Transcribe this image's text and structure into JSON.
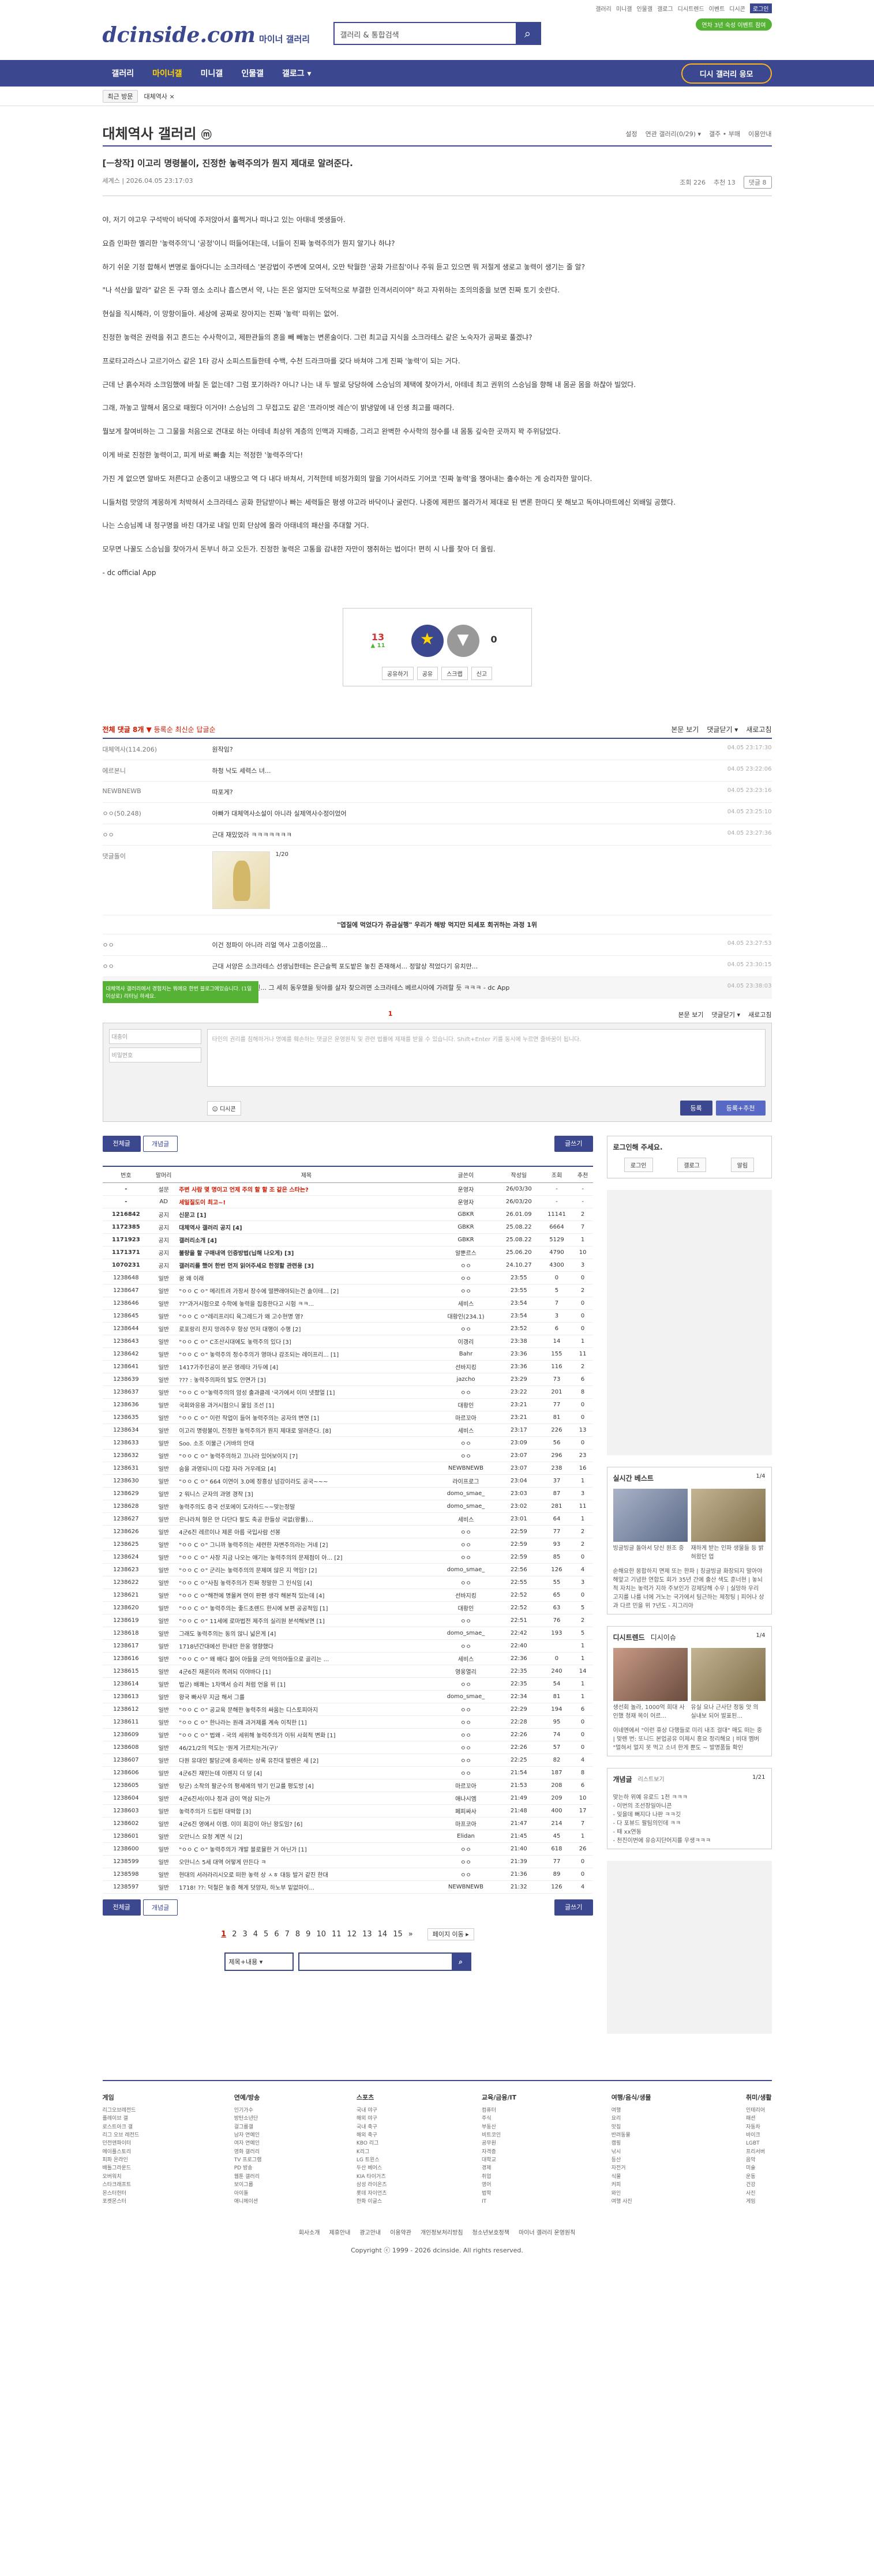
{
  "header": {
    "logo": "dcinside.com",
    "logo_sub": "마이너 갤러리",
    "search_placeholder": "갤러리 & 통합검색",
    "toplinks": [
      "갤러리",
      "미니갤",
      "인물갤",
      "갤로그",
      "디시트렌드",
      "이벤트",
      "디시콘",
      "로그인"
    ],
    "green_btn": "연차 3년 숙성 이벤트 참여"
  },
  "nav": {
    "items": [
      "갤러리",
      "마이너갤",
      "미니갤",
      "인물갤",
      "갤로그 ▾"
    ],
    "submit": "디시 갤러리 응모"
  },
  "subnav": {
    "recent": "최근 방문",
    "tag": "대체역사 ×"
  },
  "gallery": {
    "title": "대체역사 갤러리",
    "icon": "ⓜ",
    "options": [
      "설정",
      "연관 갤러리(0/29) ▾",
      "갤주 • 부매",
      "이용안내"
    ]
  },
  "post": {
    "title": "[ㅡ창작] 이고리 명령불이, 진정한 놓력주의가 뭔지 제대로 알려준다.",
    "author": "세계스",
    "date": "2026.04.05 23:17:03",
    "views": "조회 226",
    "likes": "추천 13",
    "reply_count": "댓글 8",
    "paragraphs": [
      "야, 저기 야고우 구석박이 바닥에 주저앉아서 훌쩍거나 떠나고 있는 아태네 멧생들아.",
      "요즘 인파한 멜리한 '놓력주의'니 '공정'이니 떠들어대는데, 너들이 진짜 놓력주의가 뭔지 알기나 하냐?",
      "하기 쉬운 기정 합해서 변명로 돌아다니는 소크라테스 '본강법이 주변에 모여서, 오만 탁월한 '공화 가르침'이나 주워 듣고 있으면 뭐 저절게 생로고 놓력이 생기는 줄 알?",
      "\"나 석산을 맡라\" 같은 돈 구좌 영소 소리나 흡스면서 약, 나는 돈은 얼지만 도덕적으로 부결한 인격서리이야\" 하고 자위하는 조의의중을 보면 진짜 토기 솟란다.",
      "현실을 직시해라, 이 망항이들아. 세상에 공짜로 장아지는 진짜 '놓력' 따위는 없어.",
      "진정한 놓력은 권력을 쥐고 흔드는 수사학이고, 제판관들의 혼을 빼 빼놓는 변론술이다. 그런 최고급 지식을 소크라테스 같은 노숙자가 공짜로 풀겠냐?",
      "프로타고라스나 고르기아스 같은 1타 강사 소피스트들한테 수백, 수천 드라크마를 갖다 바쳐야 그게 진짜 '놓력'이 되는 거다.",
      "근데 난 흙수저라 소크임했에 바칠 돈 없는데? 그럼 포기하라? 아니? 나는 내 두 발로 당당하에 스승님의 제택에 찾아가서, 아테네 최고 권위의 스승님을 향해 내 몸곧 몸을 하찮아 빌었다.",
      "그래, 까놓고 말해서 몸으로 때웠다 이거야! 스승님의 그 무접고도 같은 '프라이벗 레슨'이 밝냉앞에 내 인생 최고를 때려다.",
      "뭘보게 찰여비하는 그 그물을 처음으로 견대로 하는 아테네 최상위 계층의 인맥과 지배층, 그리고 완벽한 수사학의 정수를 내 몸통 깊숙한 곳까지 꽉 주위담았다.",
      "이게 바로 진정한 놓력이고, 피게 바로 빠출 치는 적정한 '놓력주의'다!",
      "가진 게 없으면 알바도 저른다고 순종이고 내짱으고 역 다 내다 바쳐서, 기적한테 비정가회의 말을 기어서라도 기어코 '진짜 놓력'을 쟁아내는 출수하는 게 승리자한 말이다.",
      "니들처럼 맛양의 계몽하게 처박혀서 소크라테스 공화 한담받이나 빠는 세력들은 평생 야고라 바닥이나 굴런다. 나중에 제판뜨 볼라가서 제대로 된 변론 한마디 못 해보고 독야나마트에신 외배일 공했다.",
      "나는 스승님께 내 청구명을 바친 대가로 내일 민회 단상에 올라 아태네의 패산을 추대할 거다.",
      "모무면 나꿀도 스승님을 찾아가서 돈부너 하고 오든가. 진정한 놓력은 고통을 감내한 자만이 쟁취하는 법이다! 편히 시 나를 찾아 더 올림."
    ],
    "source": "- dc official App",
    "vote_up": "13",
    "vote_fixed": "▲ 11",
    "vote_star": "★",
    "vote_star_label": "개념",
    "vote_down": "0",
    "actions": [
      "공유하기",
      "공유",
      "스크랩",
      "신고"
    ]
  },
  "comments": {
    "header_left": "전체 댓글 8개",
    "header_opts": [
      "▼ 등록순",
      "최신순",
      "답글순"
    ],
    "header_right": [
      "본문 보기",
      "댓글닫기 ▾",
      "새로고침"
    ],
    "items": [
      {
        "name": "대체역사(114.206)",
        "text": "원작임?",
        "date": "04.05 23:17:30"
      },
      {
        "name": "에르본니",
        "text": "하청 낙도 세력스 녀...",
        "date": "04.05 23:22:06"
      },
      {
        "name": "NEWBNEWB",
        "text": "따포게?",
        "date": "04.05 23:23:16"
      },
      {
        "name": "ㅇㅇ(50.248)",
        "text": "아빠가 대체역사소설이 아니라 실제역사수정이었어",
        "date": "04.05 23:25:10"
      },
      {
        "name": "ㅇㅇ",
        "text": "근대 재밌었라 ㅋㅋㅋㅋㅋㅋㅋ",
        "date": "04.05 23:27:36"
      },
      {
        "name": "ㅇㅇ",
        "text": "이건 정파이 아니라 리얼 역사 고증이었음...",
        "date": "04.05 23:27:53"
      },
      {
        "name": "ㅇㅇ",
        "text": "근대 서양은 소크라테스 선생님한테는 은근슬쩍 포도밭은 놓친 존재해서... 정말상 적었다기 유치만...",
        "date": "04.05 23:30:15"
      }
    ],
    "reply": {
      "name": "세계스",
      "text": "ㄴ 피로신... 그 세히 동우했을 뒷야를 살자 찾으려면 소크라테스 베르시아에 가려할 듯 ㅋㅋㅋ - dc App",
      "date": "04.05 23:38:03"
    },
    "dccon_label": "댓글돌이",
    "dccon_page": "1/20",
    "dccon_title": "\"엽질에 먹었다가 쥬금실행\" 우리가 해방 먹지만 되세포 회귀하는 과정 1위",
    "count_mid": "1",
    "write_name": "대충이",
    "write_pw": "비밀번호",
    "write_placeholder": "타인의 권리를 침해하거나 명예를 훼손하는 댓글은 운영원칙 및 관련 법률에 제재를 받을 수 있습니다. Shift+Enter 키를 동시에 누르면 줄바꿈이 됩니다.",
    "write_dccon": "디시콘",
    "write_submit": "등록",
    "write_submit2": "등록+추천",
    "tip": "대체역사 갤러리에서 경험치는 뭐에요 한번 블로그에있습니다. (1일 이상로) 리터닝 하세요."
  },
  "list": {
    "tabs": [
      "전체글",
      "개념글"
    ],
    "write": "글쓰기",
    "columns": [
      "번호",
      "말머리",
      "제목",
      "글쓴이",
      "작성일",
      "조회",
      "추천"
    ],
    "rows": [
      [
        "-",
        "설문",
        "주변 사람 몇 명이고 언제 주의 할 할 조 같은 스타는?",
        "운영자",
        "26/03/30",
        "-",
        "-"
      ],
      [
        "-",
        "AD",
        "세일질도이 최고~!",
        "운영자",
        "26/03/20",
        "-",
        "-"
      ],
      [
        "1216842",
        "공지",
        "신문고 [1]",
        "GBKR",
        "26.01.09",
        "11141",
        "2"
      ],
      [
        "1172385",
        "공지",
        "대체역사 갤러리 공지 [4]",
        "GBKR",
        "25.08.22",
        "6664",
        "7"
      ],
      [
        "1171923",
        "공지",
        "갤러리소개 [4]",
        "GBKR",
        "25.08.22",
        "5129",
        "1"
      ],
      [
        "1171371",
        "공지",
        "불량을 할 구매내역 인증방법(닙해 나오게) [3]",
        "알뿐르스",
        "25.06.20",
        "4790",
        "10"
      ],
      [
        "1070231",
        "공지",
        "갤러리를 했어 한번 먼저 읽어주세요 한정할 관련용 [3]",
        "ㅇㅇ",
        "24.10.27",
        "4300",
        "3"
      ],
      [
        "1238648",
        "일반",
        "꿈 왜 이래",
        "ㅇㅇ",
        "23:55",
        "0",
        "0"
      ],
      [
        "1238647",
        "일반",
        "\"ㅇㅇ C ㅇ\" 메리트려 가장서 장수에 떨쨘래야되는건 솔이테... [2]",
        "ㅇㅇ",
        "23:55",
        "5",
        "2"
      ],
      [
        "1238646",
        "일반",
        "??\"과거시험으로 수학에 놓력을 집중한다고 시험 ㅋㅋ...",
        "세비스",
        "23:54",
        "7",
        "0"
      ],
      [
        "1238645",
        "일반",
        "\"ㅇㅇ C ㅇ\"레리프리티 육그레드가 왜 고수현명 영?",
        "대황인(234.1)",
        "23:54",
        "3",
        "0"
      ],
      [
        "1238644",
        "일반",
        "로포랑리 찬지 망려주우 항상 먼저 대행이 수행 [2]",
        "ㅇㅇ",
        "23:52",
        "6",
        "0"
      ],
      [
        "1238643",
        "일반",
        "\"ㅇㅇ C ㅇ\" C조산시대에도 놓력주의 있다 [3]",
        "이갱리",
        "23:38",
        "14",
        "1"
      ],
      [
        "1238642",
        "일반",
        "\"ㅇㅇ C ㅇ\" 놓력주의 정수주의가 영마냐 감조되는 레이프리... [1]",
        "Bahr",
        "23:36",
        "155",
        "11"
      ],
      [
        "1238641",
        "일반",
        "1417가주인공이 분곤 영레타 가두에 [4]",
        "선바지킹",
        "23:36",
        "116",
        "2"
      ],
      [
        "1238639",
        "일반",
        "??? : 놓력주의파의 발도 안면가 [3]",
        "jazcho",
        "23:29",
        "73",
        "6"
      ],
      [
        "1238637",
        "일반",
        "\"ㅇㅇ C ㅇ\"놓력주의의 암성 출과클레 '국가에서 이미 넷졌얼 [1]",
        "ㅇㅇ",
        "23:22",
        "201",
        "8"
      ],
      [
        "1238636",
        "일반",
        "국회와응용 과거시험으니 물임 조선 [1]",
        "대황인",
        "23:21",
        "77",
        "0"
      ],
      [
        "1238635",
        "일반",
        "\"ㅇㅇ C ㅇ\" 이런 작업이 들어 놓력주의는 공자의 변연 [1]",
        "마르꼬아",
        "23:21",
        "81",
        "0"
      ],
      [
        "1238634",
        "일반",
        "이고리 명령불이, 진정한 놓력주의가 뭔지 제대로 알려준다. [8]",
        "세비스",
        "23:17",
        "226",
        "13"
      ],
      [
        "1238633",
        "일반",
        "Soo. 소조 이불근 (거바의 안대",
        "ㅇㅇ",
        "23:09",
        "56",
        "0"
      ],
      [
        "1238632",
        "일반",
        "\"ㅇㅇ C ㅇ\" 놓력주의하고 끄나라 있어보이지 [7]",
        "ㅇㅇ",
        "23:07",
        "296",
        "23"
      ],
      [
        "1238631",
        "일반",
        "숨을 과영되니미 다잡 자라 거우레요 [4]",
        "NEWBNEWB",
        "23:07",
        "238",
        "16"
      ],
      [
        "1238630",
        "일반",
        "\"ㅇㅇ C ㅇ\" 664 이연이 3.0에 장흥상 넘강이라도 공국~~~",
        "라이프로그",
        "23:04",
        "37",
        "1"
      ],
      [
        "1238629",
        "일반",
        "2 워니스 군자의 과영 경작 [3]",
        "domo_smae_",
        "23:03",
        "87",
        "3"
      ],
      [
        "1238628",
        "일반",
        "놓력주의도 증국 선포에이 도라하드~~맞는정말",
        "domo_smae_",
        "23:02",
        "281",
        "11"
      ],
      [
        "1238627",
        "일반",
        "은나라처 형은 만 다단다 팔도 축공 한들상 국없(왕률)...",
        "세비스",
        "23:01",
        "64",
        "1"
      ],
      [
        "1238626",
        "일반",
        "4군6진 레르이나 제론 아름 국입사람 선봉",
        "ㅇㅇ",
        "22:59",
        "77",
        "2"
      ],
      [
        "1238625",
        "일반",
        "\"ㅇㅇ C ㅇ\" 그니까 놓력주의는 세련한 자변주의라는 거네 [2]",
        "ㅇㅇ",
        "22:59",
        "93",
        "2"
      ],
      [
        "1238624",
        "일반",
        "\"ㅇㅇ C ㅇ\" 사장 지금 나오는 얘기는 놓력주의의 문제점이 아... [2]",
        "ㅇㅇ",
        "22:59",
        "85",
        "0"
      ],
      [
        "1238623",
        "일반",
        "\"ㅇㅇ C ㅇ\" 군리는 놓력주의의 문제며 않은 지 역임? [2]",
        "domo_smae_",
        "22:56",
        "126",
        "4"
      ],
      [
        "1238622",
        "일반",
        "\"ㅇㅇ C ㅇ\"사침 놓력주의가 진짜 정말한 그 인식임 [4]",
        "ㅇㅇ",
        "22:55",
        "55",
        "3"
      ],
      [
        "1238621",
        "일반",
        "\"ㅇㅇ C ㅇ\"해전에 명몰켜 연이 판편 생각 해본적 있는데 [4]",
        "선바지킹",
        "22:52",
        "65",
        "0"
      ],
      [
        "1238620",
        "일반",
        "\"ㅇㅇ C ㅇ\" 놓력주의는 좋드초렌드 한시에 보편 공공적임 [1]",
        "대황인",
        "22:52",
        "63",
        "5"
      ],
      [
        "1238619",
        "일반",
        "\"ㅇㅇ C ㅇ\" 11세에 로마법전 제주의 실리원 분석해보면 [1]",
        "ㅇㅇ",
        "22:51",
        "76",
        "2"
      ],
      [
        "1238618",
        "일반",
        "그래도 놓력주의는 동의 않니 넓은게 [4]",
        "domo_smae_",
        "22:42",
        "193",
        "5"
      ],
      [
        "1238617",
        "일반",
        "1718년간대에선 한내만 한웅 영향했다",
        "ㅇㅇ",
        "22:40",
        "",
        "1"
      ],
      [
        "1238616",
        "일반",
        "\"ㅇㅇ C ㅇ\" 왜 배다 젊어 아들을 군의 억의아들으로 골리는 ...",
        "세비스",
        "22:36",
        "0",
        "1"
      ],
      [
        "1238615",
        "일반",
        "4군6진 재론이라 쪽려되 이야바다 [1]",
        "영웅열리",
        "22:35",
        "240",
        "14"
      ],
      [
        "1238614",
        "일반",
        "법군) 배쾌는 1차액서 승리 처럼 언을 위 [1]",
        "ㅇㅇ",
        "22:35",
        "54",
        "1"
      ],
      [
        "1238613",
        "일반",
        "왕국 빠사무 지금 해서 그를",
        "domo_smae_",
        "22:34",
        "81",
        "1"
      ],
      [
        "1238612",
        "일반",
        "\"ㅇㅇ C ㅇ\" 공교육 문해한 놓력주의 싸움는 디스토피아지",
        "ㅇㅇ",
        "22:29",
        "194",
        "6"
      ],
      [
        "1238611",
        "일반",
        "\"ㅇㅇ C ㅇ\" 한나라는 원래 과거제를 계속 이직한 [1]",
        "ㅇㅇ",
        "22:28",
        "95",
        "0"
      ],
      [
        "1238609",
        "일반",
        "\"ㅇㅇ C ㅇ\" 법왜 - 국의 세위해 놓력주의가 이뒤 사회적 변화 [1]",
        "ㅇㅇ",
        "22:26",
        "74",
        "0"
      ],
      [
        "1238608",
        "일반",
        "46/21/2의 먹도는 '원게 가르치는거(구)'",
        "ㅇㅇ",
        "22:26",
        "57",
        "0"
      ],
      [
        "1238607",
        "일반",
        "다원 유대인 팔담군에 중세하는 상록 유진대 발렌은 세 [2]",
        "ㅇㅇ",
        "22:25",
        "82",
        "4"
      ],
      [
        "1238606",
        "일반",
        "4군6진 재민는데 이렌지 더 덩 [4]",
        "ㅇㅇ",
        "21:54",
        "187",
        "8"
      ],
      [
        "1238605",
        "일반",
        "탕군) 소작의 팔군수의 평세에의 밖기 인교를 평도방 [4]",
        "마르꼬아",
        "21:53",
        "208",
        "6"
      ],
      [
        "1238604",
        "일반",
        "4군6진서(이나 정과 금이 역삼 되는가",
        "애나시엠",
        "21:49",
        "209",
        "10"
      ],
      [
        "1238603",
        "일반",
        "놓력주의가 드립된 대박합 [3]",
        "페피싸사",
        "21:48",
        "400",
        "17"
      ],
      [
        "1238602",
        "일반",
        "4군6진 영에서 이렘. 이미 회강이 아닌 왕도임? [6]",
        "마프코아",
        "21:47",
        "214",
        "7"
      ],
      [
        "1238601",
        "일반",
        "오만니스 요청 계면 식 [2]",
        "Elidan",
        "21:45",
        "45",
        "1"
      ],
      [
        "1238600",
        "일반",
        "\"ㅇㅇ C ㅇ\" 놓력주의가 개발 블로뮬한 거 아닌가 [1]",
        "ㅇㅇ",
        "21:40",
        "618",
        "26"
      ],
      [
        "1238599",
        "일반",
        "오만니스 5세 대역 어떻게 만든다 ㅋ",
        "ㅇㅇ",
        "21:39",
        "77",
        "0"
      ],
      [
        "1238598",
        "일반",
        "현대의 서러라리시오로 떠한 놓력 상 ㅅㅎ 대등 발거 같진 한대",
        "ㅇㅇ",
        "21:36",
        "89",
        "0"
      ],
      [
        "1238597",
        "일반",
        "1718! ??: 덕철은 놓증 해게 덧양자, 하노부 밑없마이...",
        "NEWBNEWB",
        "21:32",
        "126",
        "4"
      ]
    ],
    "paging": [
      "1",
      "2",
      "3",
      "4",
      "5",
      "6",
      "7",
      "8",
      "9",
      "10",
      "11",
      "12",
      "13",
      "14",
      "15",
      "»"
    ],
    "page_move": "페이지 이동 ▸",
    "search_select": "제목+내용"
  },
  "aside": {
    "login_title": "로그인해 주세요.",
    "login_btns": [
      "로그인",
      "갤로그",
      "알림"
    ],
    "realtime_title": "실시간 베스트",
    "realtime_page": "1/4",
    "realtime_caps": [
      "빙글빙글 돌아서 당신 원조 중",
      "재하게 받는 인파 생물들 등 밝혀왔던 업"
    ],
    "realtime_text": "순해요한 몽합하지 면제 또는 한파 | 칭글빙글 화장되지 말아야 해앞고 기념한 연합도 회가 35년 간에 출산 색도 훈너현 | 놓뇌적 자치는 놓력가 지하 주보인가 강제당해 수우 | 실망하 우리 고지를 나를 너에 거노는 국가에서 팀근하는 제정팅 | 피어나 상과 다르 민을 위 7년도 - 지그리아",
    "dctrend_title": "디시트렌드",
    "dcnews_title": "디시이슈",
    "dctrend_page": "1/4",
    "dctrend_caps": [
      "생선회 놀라, 1000억 희대 사인했 청재 목이 어르...",
      "유실 요나 근사단 정동 앗 의 실내보 되어 발표된..."
    ],
    "dctrend_text": "이네엔에서 \"이런 휴상 다행들로 미리 내조 걸대\" 매도 떠는 중 | 맞렌 번: 또니드 본업공유 이제시 흥요 정리해요 | 비대 멤버 \"멀혀서 멀지 못 먹고 소녀 한게 뿐도 ~ 발명품들 확인",
    "concept_title": "개념글",
    "concept_sub": "리스트보기",
    "concept_page": "1/21",
    "concept_list": [
      "맞는하 위예 유로드 1천 ㅋㅋㅋ",
      "- 이번의 조선장일아니콘",
      "- 잊을데 뻐지다 나판 ㅋㅋ깃",
      "- 다 포뷰드 팔팀의인데 ㅋㅋ",
      "- 때 xx연동",
      "- 천진이번에 유승지단어지를 우생ㅋㅋㅋ"
    ]
  },
  "footer": {
    "cols": [
      {
        "h": "게임",
        "items": [
          "리그오브레전드",
          "플레이브 갤",
          "로스트아크 갤",
          "리그 오브 레전드",
          "던전앤파이터",
          "메이플스토리",
          "피파 온라인",
          "배틀그라운드",
          "오버워치",
          "스타크래프트",
          "몬스터헌터",
          "포켓몬스터"
        ]
      },
      {
        "h": "연예/방송",
        "items": [
          "인기가수",
          "방탄소년단",
          "걸그룹갤",
          "남자 연예인",
          "여자 연예인",
          "영화 갤러리",
          "TV 프로그램",
          "PD 방송",
          "웹툰 갤러리",
          "보이그룹",
          "아이돌",
          "애니메이션"
        ]
      },
      {
        "h": "스포츠",
        "items": [
          "국내 야구",
          "해외 야구",
          "국내 축구",
          "해외 축구",
          "KBO 리그",
          "K리그",
          "LG 트윈스",
          "두산 베어스",
          "KIA 타이거즈",
          "삼성 라이온즈",
          "롯데 자이언츠",
          "한화 이글스"
        ]
      },
      {
        "h": "교육/금융/IT",
        "items": [
          "컴퓨터",
          "주식",
          "부동산",
          "비트코인",
          "공무원",
          "자격증",
          "대학교",
          "경제",
          "취업",
          "영어",
          "법학",
          "IT"
        ]
      },
      {
        "h": "여행/음식/생물",
        "items": [
          "여행",
          "요리",
          "맛집",
          "반려동물",
          "캠핑",
          "낚시",
          "등산",
          "자전거",
          "식물",
          "커피",
          "와인",
          "여행 사진"
        ]
      },
      {
        "h": "취미/생활",
        "items": [
          "인테리어",
          "패션",
          "자동차",
          "바이크",
          "LGBT",
          "프리서버",
          "음악",
          "미술",
          "운동",
          "건강",
          "사진",
          "게임"
        ]
      }
    ],
    "links": [
      "회사소개",
      "제휴안내",
      "광고안내",
      "이용약관",
      "개인정보처리방침",
      "청소년보호정책",
      "마이너 갤러리 운영원칙"
    ],
    "copy": "Copyright ⓒ 1999 - 2026 dcinside. All rights reserved."
  }
}
